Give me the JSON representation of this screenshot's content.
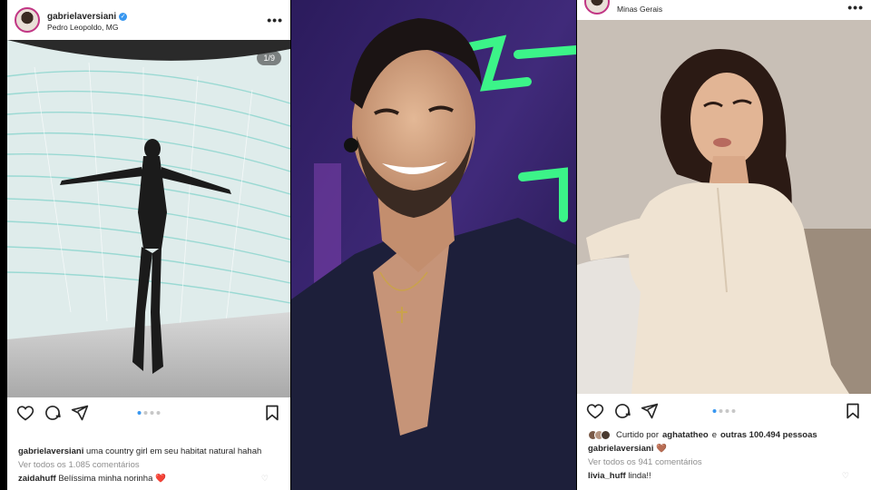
{
  "left_post": {
    "username": "gabrielaversiani",
    "verified_mark": "✓",
    "location": "Pedro Leopoldo, MG",
    "more_label": "•••",
    "carousel_counter": "1/9",
    "carousel_dots": 4,
    "carousel_active": 0,
    "caption_user": "gabrielaversiani",
    "caption_text": "uma country girl em seu habitat natural hahah",
    "view_comments": "Ver todos os 1.085 comentários",
    "comment_user": "zaidahuff",
    "comment_text": "Belíssima minha norinha",
    "comment_emoji": "❤️",
    "icons": [
      "heart-icon",
      "comment-icon",
      "share-icon",
      "bookmark-icon"
    ]
  },
  "right_post": {
    "location": "Minas Gerais",
    "more_label": "•••",
    "carousel_dots": 4,
    "carousel_active": 0,
    "liked_by_prefix": "Curtido por",
    "liked_by_user": "aghatatheo",
    "liked_by_suffix": "e",
    "liked_by_others": "outras 100.494 pessoas",
    "caption_user": "gabrielaversiani",
    "caption_emoji": "🤎",
    "view_comments": "Ver todos os 941 comentários",
    "comment_user": "livia_huff",
    "comment_text": "linda!!",
    "icons": [
      "heart-icon",
      "comment-icon",
      "share-icon",
      "bookmark-icon"
    ]
  },
  "colors": {
    "instagram_blue": "#3897f0",
    "text": "#262626",
    "muted": "#8e8e8e",
    "neon_green": "#3cff8a",
    "stage_purple": "#2a1a55"
  }
}
